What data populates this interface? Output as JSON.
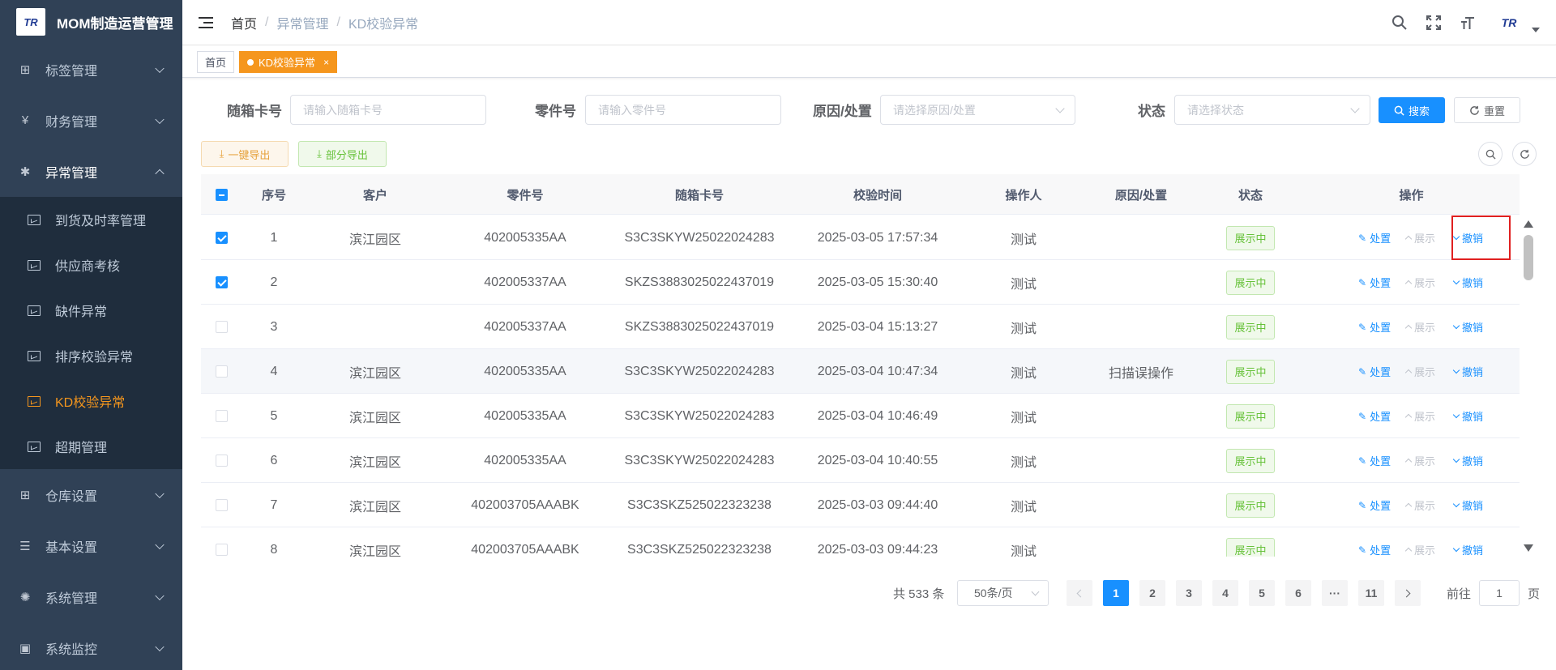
{
  "app": {
    "logo_text": "TR",
    "title": "MOM制造运营管理",
    "avatar_text": "TR"
  },
  "sidebar": {
    "menus_top": [
      {
        "icon": "⊞",
        "label": "标签管理"
      },
      {
        "icon": "¥",
        "label": "财务管理"
      }
    ],
    "open_menu": {
      "icon": "✱",
      "label": "异常管理"
    },
    "submenu": [
      {
        "label": "到货及时率管理"
      },
      {
        "label": "供应商考核"
      },
      {
        "label": "缺件异常"
      },
      {
        "label": "排序校验异常"
      },
      {
        "label": "KD校验异常"
      },
      {
        "label": "超期管理"
      }
    ],
    "menus_bottom": [
      {
        "icon": "⊞",
        "label": "仓库设置"
      },
      {
        "icon": "☰",
        "label": "基本设置"
      },
      {
        "icon": "✺",
        "label": "系统管理"
      },
      {
        "icon": "▣",
        "label": "系统监控"
      }
    ]
  },
  "breadcrumb": {
    "home": "首页",
    "parent": "异常管理",
    "current": "KD校验异常",
    "sep": "/"
  },
  "tags": {
    "home": "首页",
    "active": "KD校验异常",
    "close": "×"
  },
  "search": {
    "box_label": "随箱卡号",
    "box_placeholder": "请输入随箱卡号",
    "part_label": "零件号",
    "part_placeholder": "请输入零件号",
    "reason_label": "原因/处置",
    "reason_placeholder": "请选择原因/处置",
    "status_label": "状态",
    "status_placeholder": "请选择状态",
    "search_btn": "搜索",
    "reset_btn": "重置"
  },
  "actions": {
    "export_all": "一键导出",
    "export_part": "部分导出"
  },
  "table": {
    "headers": {
      "index": "序号",
      "customer": "客户",
      "part": "零件号",
      "box": "随箱卡号",
      "time": "校验时间",
      "operator": "操作人",
      "reason": "原因/处置",
      "status": "状态",
      "ops": "操作"
    },
    "op_labels": {
      "handle": "处置",
      "show": "展示",
      "revoke": "撤销"
    },
    "rows": [
      {
        "index": "1",
        "customer": "滨江园区",
        "part": "402005335AA",
        "box": "S3C3SKYW25022024283",
        "time": "2025-03-05 17:57:34",
        "operator": "测试",
        "reason": "",
        "status": "展示中"
      },
      {
        "index": "2",
        "customer": "",
        "part": "402005337AA",
        "box": "SKZS3883025022437019",
        "time": "2025-03-05 15:30:40",
        "operator": "测试",
        "reason": "",
        "status": "展示中"
      },
      {
        "index": "3",
        "customer": "",
        "part": "402005337AA",
        "box": "SKZS3883025022437019",
        "time": "2025-03-04 15:13:27",
        "operator": "测试",
        "reason": "",
        "status": "展示中"
      },
      {
        "index": "4",
        "customer": "滨江园区",
        "part": "402005335AA",
        "box": "S3C3SKYW25022024283",
        "time": "2025-03-04 10:47:34",
        "operator": "测试",
        "reason": "扫描误操作",
        "status": "展示中"
      },
      {
        "index": "5",
        "customer": "滨江园区",
        "part": "402005335AA",
        "box": "S3C3SKYW25022024283",
        "time": "2025-03-04 10:46:49",
        "operator": "测试",
        "reason": "",
        "status": "展示中"
      },
      {
        "index": "6",
        "customer": "滨江园区",
        "part": "402005335AA",
        "box": "S3C3SKYW25022024283",
        "time": "2025-03-04 10:40:55",
        "operator": "测试",
        "reason": "",
        "status": "展示中"
      },
      {
        "index": "7",
        "customer": "滨江园区",
        "part": "402003705AAABK",
        "box": "S3C3SKZ525022323238",
        "time": "2025-03-03 09:44:40",
        "operator": "测试",
        "reason": "",
        "status": "展示中"
      },
      {
        "index": "8",
        "customer": "滨江园区",
        "part": "402003705AAABK",
        "box": "S3C3SKZ525022323238",
        "time": "2025-03-03 09:44:23",
        "operator": "测试",
        "reason": "",
        "status": "展示中"
      }
    ]
  },
  "pagination": {
    "total": "共 533 条",
    "page_size": "50条/页",
    "pages": [
      "1",
      "2",
      "3",
      "4",
      "5",
      "6",
      "···",
      "11"
    ],
    "goto_label": "前往",
    "goto_value": "1",
    "goto_suffix": "页"
  },
  "colors": {
    "accent": "#f5961d",
    "primary": "#1890ff",
    "sidebar_bg": "#304156",
    "success": "#67c23a",
    "highlight": "#e02020"
  }
}
